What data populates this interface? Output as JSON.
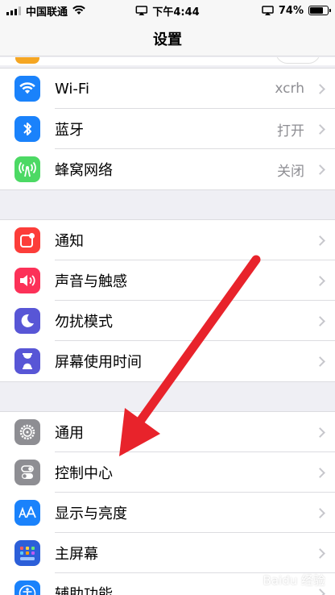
{
  "status_bar": {
    "carrier": "中国联通",
    "time": "下午4:44",
    "battery": "74%",
    "battery_level": 0.74
  },
  "nav": {
    "title": "设置"
  },
  "groups": [
    {
      "items": [
        {
          "label": "Wi-Fi",
          "value": "xcrh",
          "icon": "wifi-icon",
          "color": "#1a82fb"
        },
        {
          "label": "蓝牙",
          "value": "打开",
          "icon": "bluetooth-icon",
          "color": "#1a82fb"
        },
        {
          "label": "蜂窝网络",
          "value": "关闭",
          "icon": "cellular-icon",
          "color": "#4cd964"
        }
      ]
    },
    {
      "items": [
        {
          "label": "通知",
          "value": "",
          "icon": "notifications-icon",
          "color": "#fc3d39"
        },
        {
          "label": "声音与触感",
          "value": "",
          "icon": "sound-icon",
          "color": "#fc3158"
        },
        {
          "label": "勿扰模式",
          "value": "",
          "icon": "moon-icon",
          "color": "#5856d6"
        },
        {
          "label": "屏幕使用时间",
          "value": "",
          "icon": "hourglass-icon",
          "color": "#5856d6"
        }
      ]
    },
    {
      "items": [
        {
          "label": "通用",
          "value": "",
          "icon": "gear-icon",
          "color": "#8e8e93"
        },
        {
          "label": "控制中心",
          "value": "",
          "icon": "switches-icon",
          "color": "#8e8e93"
        },
        {
          "label": "显示与亮度",
          "value": "",
          "icon": "display-icon",
          "color": "#1a82fb"
        },
        {
          "label": "主屏幕",
          "value": "",
          "icon": "home-screen-icon",
          "color": "#2c5fd9"
        },
        {
          "label": "辅助功能",
          "value": "",
          "icon": "accessibility-icon",
          "color": "#1a82fb"
        }
      ]
    }
  ],
  "overlay": {
    "arrow_color": "#e8232b"
  },
  "watermark": "Baidu 经验"
}
